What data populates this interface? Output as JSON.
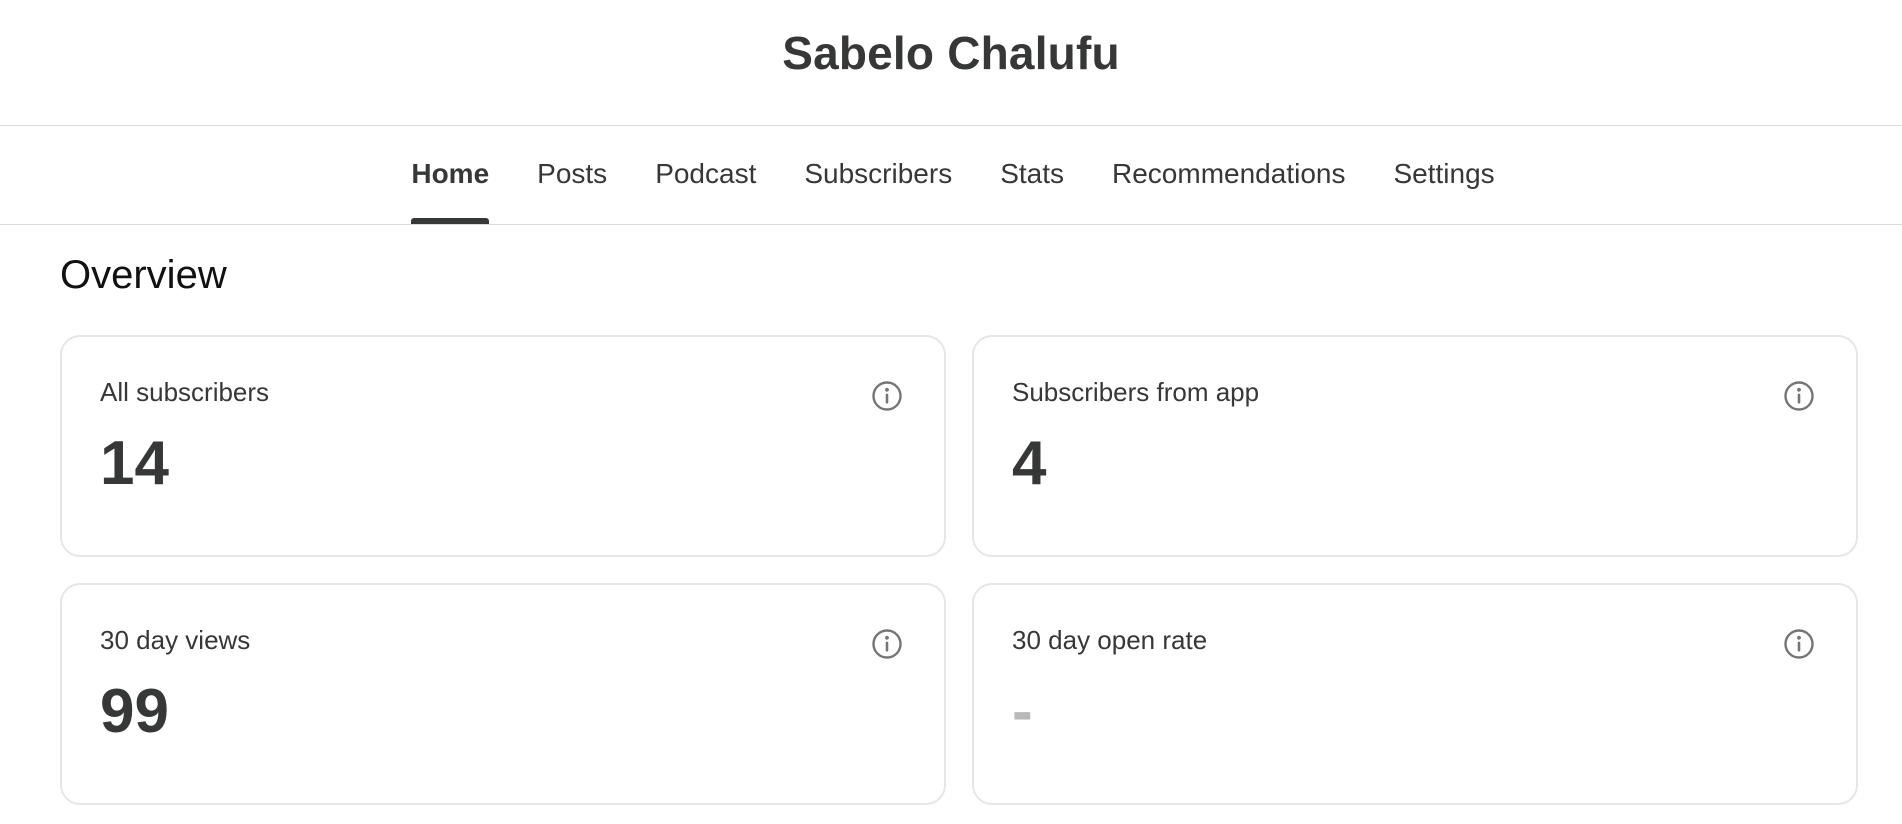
{
  "header": {
    "title": "Sabelo Chalufu"
  },
  "nav": {
    "tabs": [
      {
        "label": "Home",
        "active": true
      },
      {
        "label": "Posts"
      },
      {
        "label": "Podcast"
      },
      {
        "label": "Subscribers"
      },
      {
        "label": "Stats"
      },
      {
        "label": "Recommendations"
      },
      {
        "label": "Settings"
      }
    ]
  },
  "overview": {
    "title": "Overview",
    "cards": [
      {
        "label": "All subscribers",
        "value": "14",
        "icon": "info-icon"
      },
      {
        "label": "Subscribers from app",
        "value": "4",
        "icon": "info-icon"
      },
      {
        "label": "30 day views",
        "value": "99",
        "icon": "info-icon"
      },
      {
        "label": "30 day open rate",
        "value": "-",
        "icon": "info-icon"
      }
    ]
  },
  "colors": {
    "text": "#363737",
    "border": "#e6e6e6",
    "muted_value": "#b8b8b8",
    "icon": "#757575"
  }
}
